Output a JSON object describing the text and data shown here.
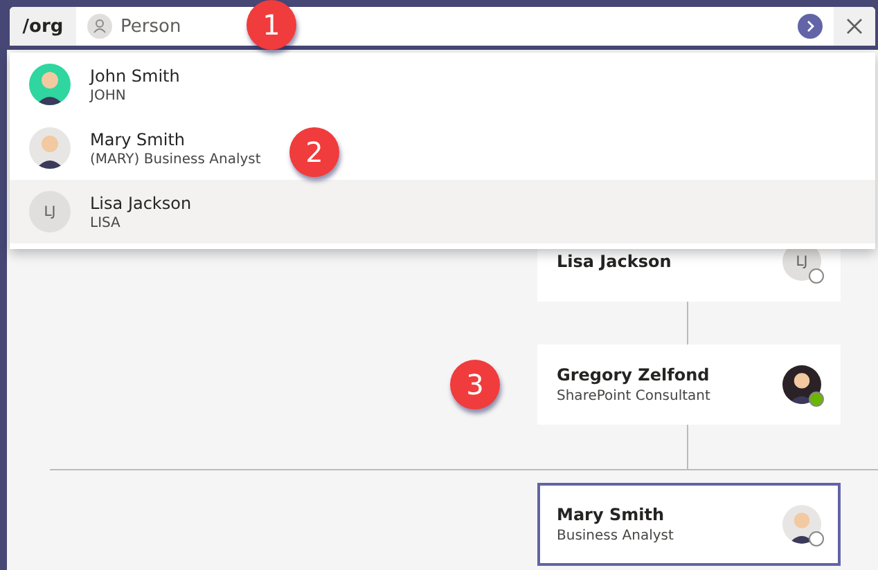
{
  "command_bar": {
    "command": "/org",
    "placeholder": "Person"
  },
  "suggestions": [
    {
      "name": "John Smith",
      "detail": "JOHN",
      "selected": false
    },
    {
      "name": "Mary Smith",
      "detail": "(MARY) Business Analyst",
      "selected": false
    },
    {
      "name": "Lisa Jackson",
      "detail": "LISA",
      "avatar": {
        "kind": "initials",
        "initials": "LJ"
      },
      "selected": true
    }
  ],
  "org_chart": {
    "manager": {
      "name": "Lisa Jackson",
      "avatar": {
        "kind": "initials",
        "initials": "LJ"
      },
      "available": false
    },
    "person": {
      "name": "Gregory Zelfond",
      "title": "SharePoint Consultant",
      "available": true
    },
    "reports": [
      {
        "name": "Mary Smith",
        "title": "Business Analyst",
        "available": false,
        "selected": true
      }
    ]
  },
  "callouts": [
    {
      "number": "1"
    },
    {
      "number": "2"
    },
    {
      "number": "3"
    }
  ]
}
